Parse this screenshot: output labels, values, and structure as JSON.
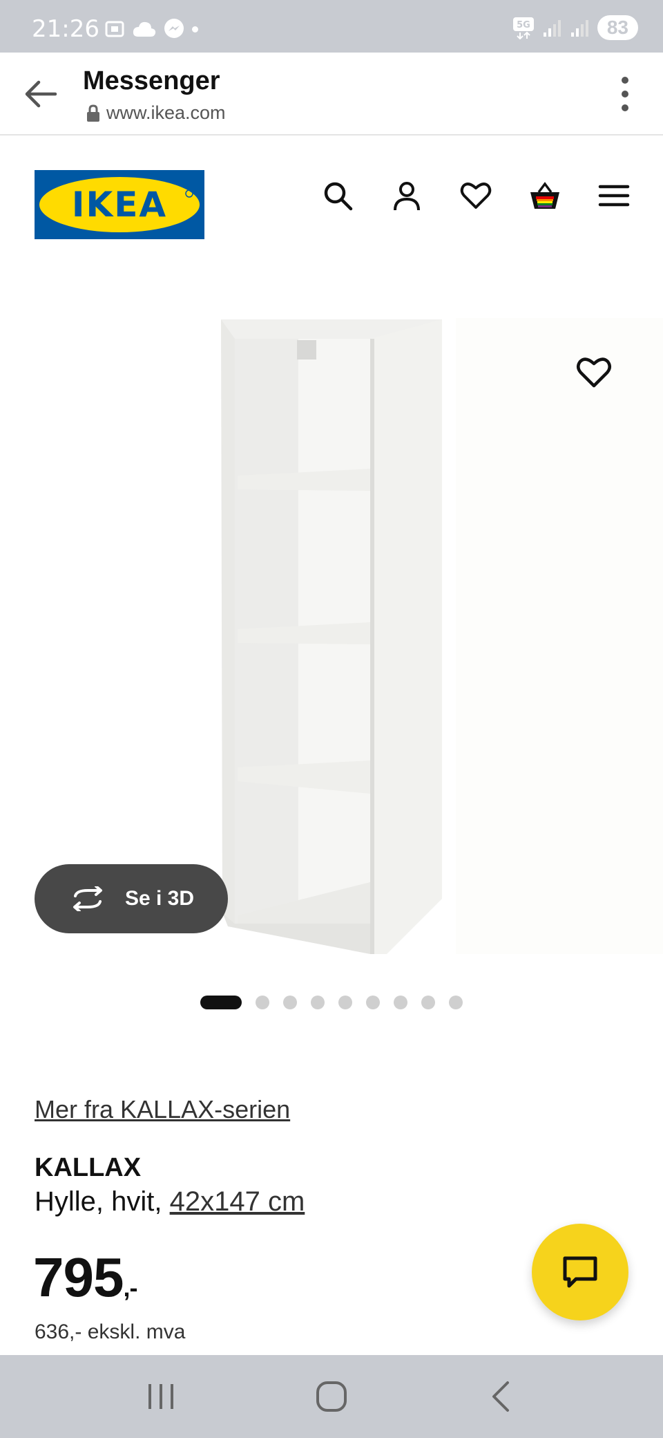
{
  "status_bar": {
    "time": "21:26",
    "network": "5G",
    "battery": "83"
  },
  "browser": {
    "title": "Messenger",
    "url": "www.ikea.com"
  },
  "header": {
    "logo_text": "IKEA",
    "icons": [
      "search-icon",
      "account-icon",
      "heart-icon",
      "basket-icon",
      "menu-icon"
    ]
  },
  "gallery": {
    "view_3d_label": "Se i 3D",
    "slide_count": 9,
    "active_slide": 1
  },
  "product": {
    "series_link": "Mer fra KALLAX-serien",
    "name": "KALLAX",
    "description_prefix": "Hylle, hvit, ",
    "size_link": "42x147 cm",
    "price_main": "795",
    "price_suffix": ",-",
    "price_excl_vat": "636,- ekskl. mva"
  },
  "colors": {
    "ikea_blue": "#0058a3",
    "ikea_yellow": "#ffdb00",
    "chat_fab": "#f6d31c",
    "system_bar": "#c8cbd1"
  }
}
